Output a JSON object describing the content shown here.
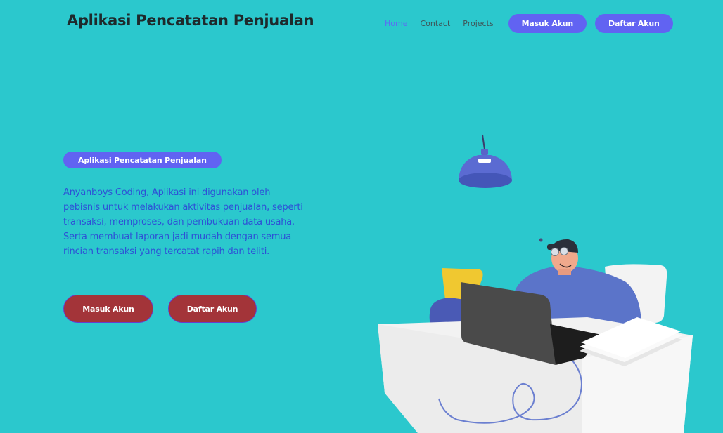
{
  "header": {
    "brand": "Aplikasi Pencatatan Penjualan",
    "nav": [
      {
        "label": "Home",
        "active": true
      },
      {
        "label": "Contact",
        "active": false
      },
      {
        "label": "Projects",
        "active": false
      }
    ],
    "login_label": "Masuk Akun",
    "register_label": "Daftar Akun"
  },
  "hero": {
    "badge": "Aplikasi Pencatatan Penjualan",
    "description": "Anyanboys Coding, Aplikasi ini digunakan oleh pebisnis untuk melakukan aktivitas penjualan, seperti transaksi, memproses, dan pembukuan data usaha. Serta membuat laporan jadi mudah dengan semua rincian transaksi yang tercatat rapih dan teliti.",
    "login_label": "Masuk Akun",
    "register_label": "Daftar Akun"
  },
  "colors": {
    "background": "#2bc8cd",
    "accent": "#6163f2",
    "cta": "#a33439",
    "text_blue": "#2d51d6"
  },
  "illustration": {
    "subject": "person-working-at-laptop"
  }
}
